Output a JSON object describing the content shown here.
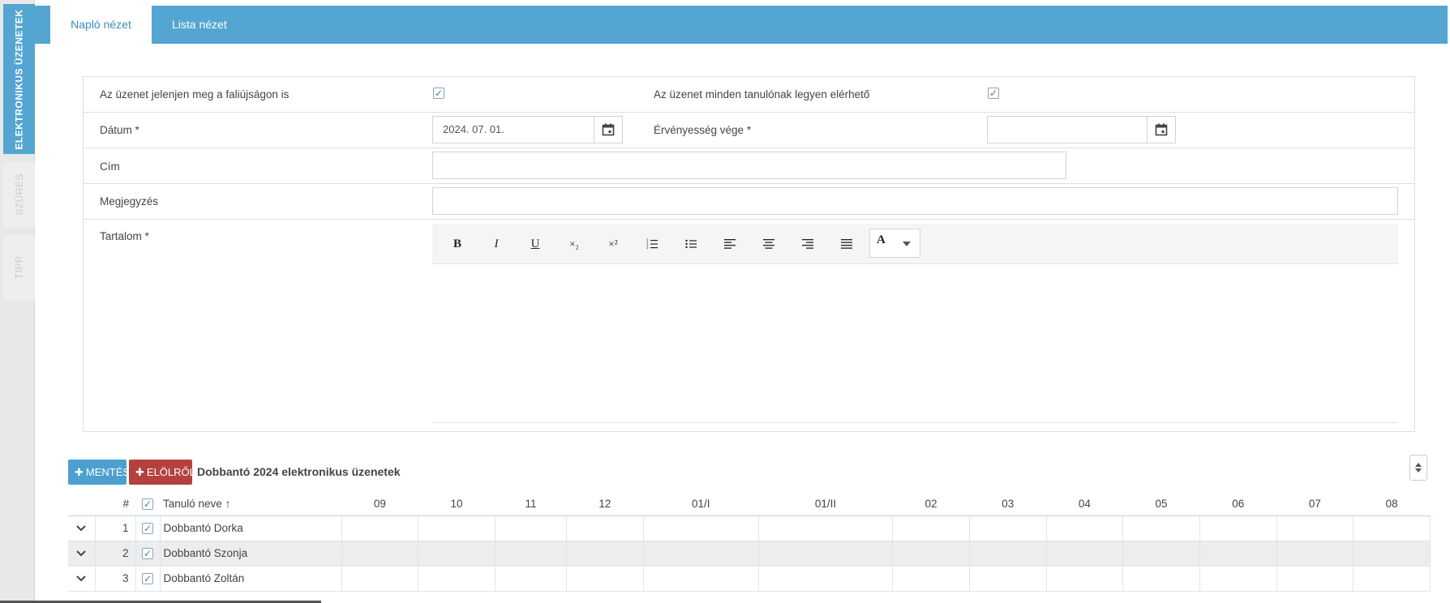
{
  "sidebar": {
    "tabs": [
      {
        "label": "ELEKTRONIKUS ÜZENETEK"
      },
      {
        "label": "SZŰRÉS"
      },
      {
        "label": "TIPP"
      }
    ]
  },
  "top_tabs": [
    {
      "label": "Napló nézet"
    },
    {
      "label": "Lista nézet"
    }
  ],
  "form": {
    "wall_label": "Az üzenet jelenjen meg a faliújságon is",
    "all_students_label": "Az üzenet minden tanulónak legyen elérhető",
    "date_label": "Dátum *",
    "date_value": "2024. 07. 01.",
    "validity_label": "Érvényesség vége *",
    "validity_value": "",
    "title_label": "Cím",
    "title_value": "",
    "note_label": "Megjegyzés",
    "note_value": "",
    "content_label": "Tartalom *"
  },
  "editor": {
    "bold": "B",
    "italic": "I",
    "underline": "U",
    "subscript": "×₂",
    "superscript": "×²",
    "font_color": "A"
  },
  "actions": {
    "save_label": "MENTÉS",
    "reset_label": "ELÖLRŐL",
    "title": "Dobbantó 2024 elektronikus üzenetek"
  },
  "grid": {
    "headers": {
      "number": "#",
      "name": "Tanuló neve",
      "months": [
        "09",
        "10",
        "11",
        "12",
        "01/I",
        "01/II",
        "02",
        "03",
        "04",
        "05",
        "06",
        "07",
        "08"
      ]
    },
    "rows": [
      {
        "num": "1",
        "name": "Dobbantó Dorka"
      },
      {
        "num": "2",
        "name": "Dobbantó Szonja"
      },
      {
        "num": "3",
        "name": "Dobbantó Zoltán"
      }
    ]
  }
}
